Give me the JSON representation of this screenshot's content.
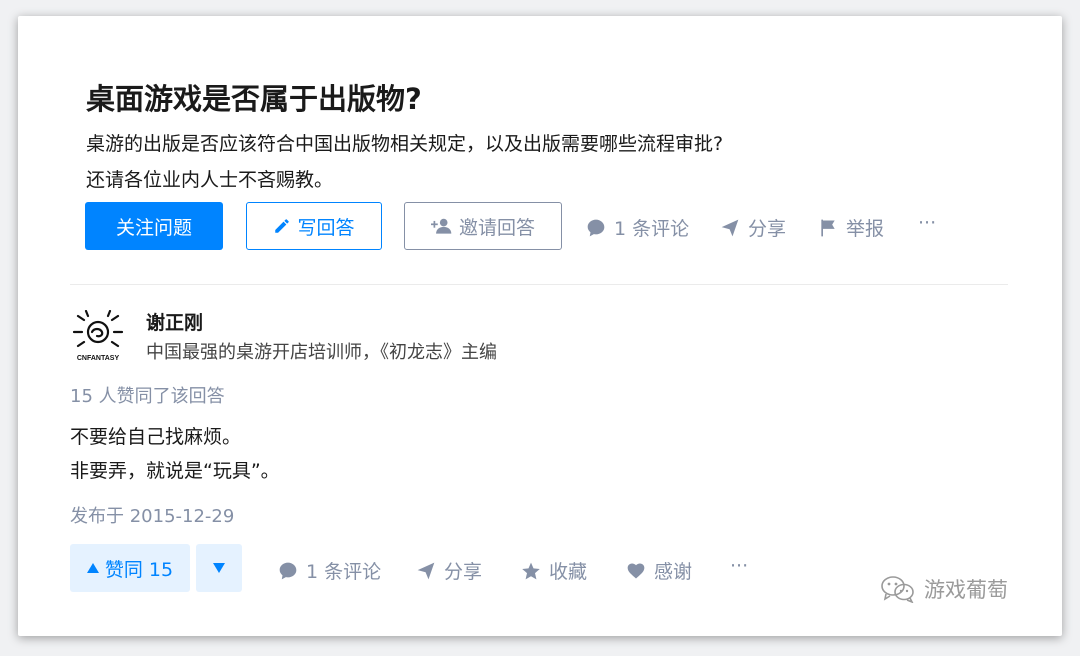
{
  "question": {
    "title": "桌面游戏是否属于出版物?",
    "description": [
      "桌游的出版是否应该符合中国出版物相关规定，以及出版需要哪些流程审批?",
      "还请各位业内人士不吝赐教。"
    ],
    "follow_label": "关注问题",
    "write_label": "写回答",
    "invite_label": "邀请回答",
    "comments_label": "1 条评论",
    "share_label": "分享",
    "report_label": "举报",
    "more_label": "···"
  },
  "answer": {
    "author_name": "谢正刚",
    "author_bio": "中国最强的桌游开店培训师，《初龙志》主编",
    "avatar_logo_text": "CNFANTASY",
    "votes_summary": "15 人赞同了该回答",
    "body": [
      "不要给自己找麻烦。",
      "非要弄，就说是“玩具”。"
    ],
    "published": "发布于 2015-12-29",
    "upvote_label": "赞同 15",
    "comments_label": "1 条评论",
    "share_label": "分享",
    "collect_label": "收藏",
    "thanks_label": "感谢",
    "more_label": "···"
  },
  "watermark": {
    "text": "游戏葡萄"
  },
  "colors": {
    "accent": "#0084ff",
    "muted": "#8590a6",
    "accent_light": "#e5f2ff"
  }
}
